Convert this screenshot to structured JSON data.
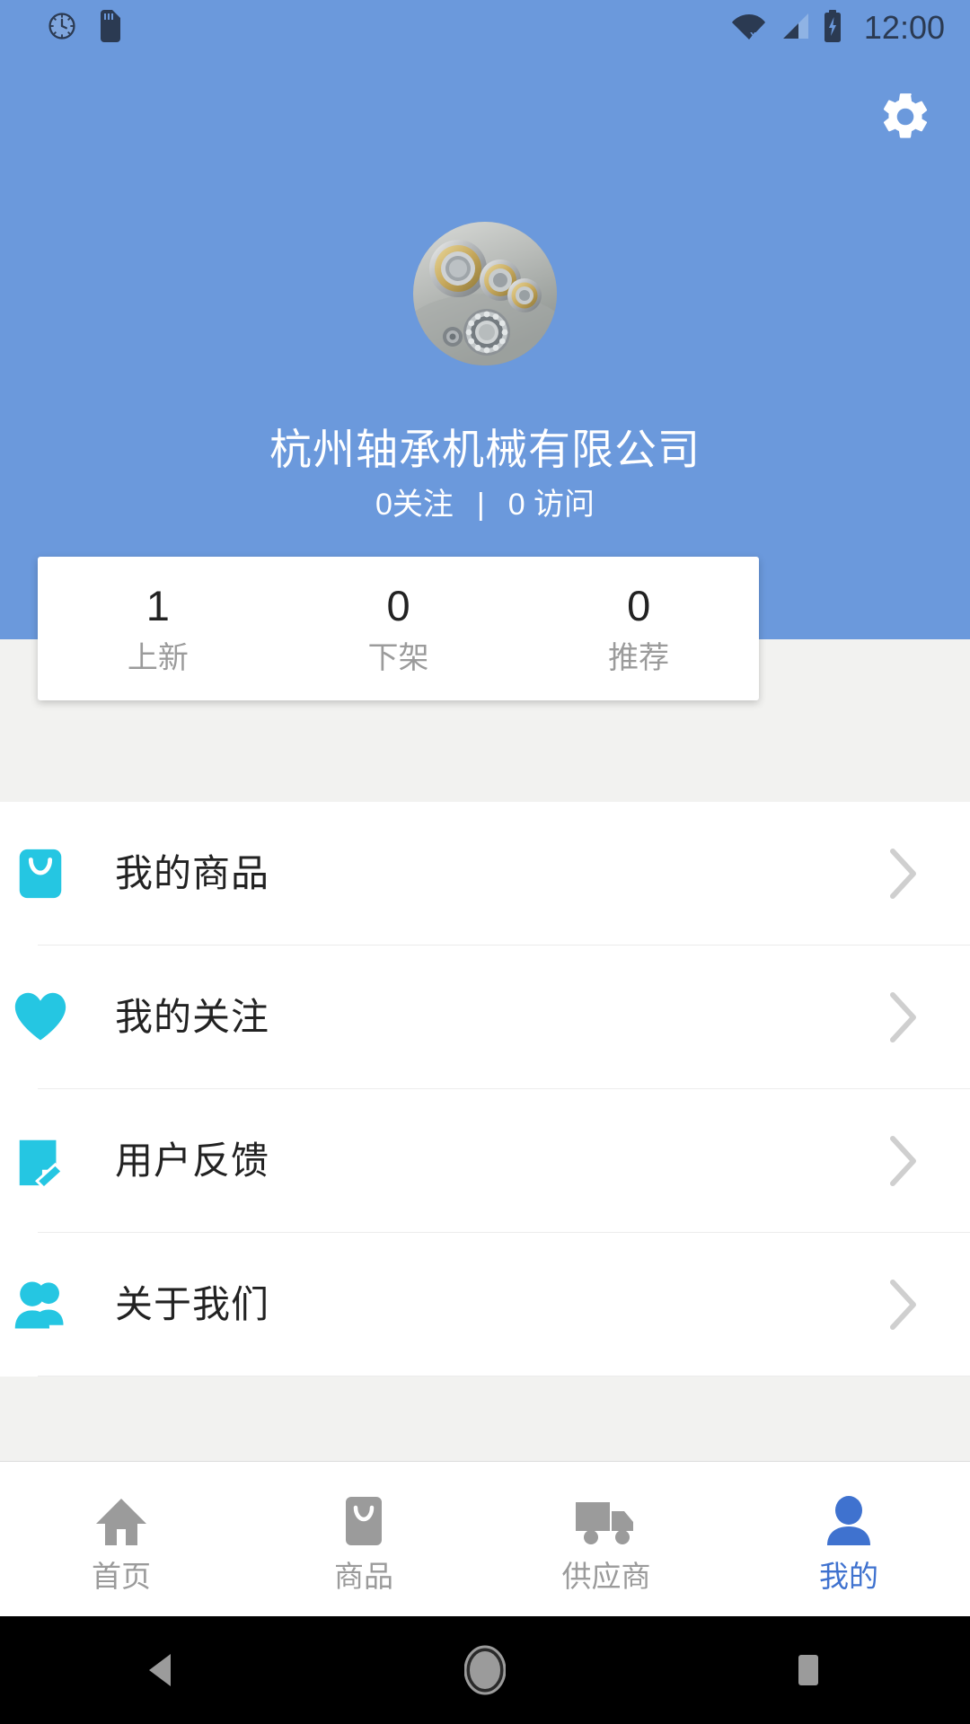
{
  "status_bar": {
    "time": "12:00",
    "icons": [
      "clock-icon",
      "sd-card-icon",
      "wifi-off-icon",
      "cellular-signal-icon",
      "battery-charging-icon"
    ]
  },
  "header": {
    "settings_label": "gear-icon",
    "avatar_alt": "ball-bearings-photo",
    "company_name": "杭州轴承机械有限公司",
    "followers": "0关注",
    "separator": "|",
    "visits": "0 访问",
    "background_color": "#6b99dc"
  },
  "stats": {
    "items": [
      {
        "value": "1",
        "label": "上新"
      },
      {
        "value": "0",
        "label": "下架"
      },
      {
        "value": "0",
        "label": "推荐"
      }
    ]
  },
  "menu": {
    "items": [
      {
        "label": "我的商品",
        "icon": "shopping-bag-icon",
        "icon_color": "#25c6e2"
      },
      {
        "label": "我的关注",
        "icon": "heart-icon",
        "icon_color": "#25c6e2"
      },
      {
        "label": "用户反馈",
        "icon": "edit-note-icon",
        "icon_color": "#25c6e2"
      },
      {
        "label": "关于我们",
        "icon": "people-group-icon",
        "icon_color": "#25c6e2"
      }
    ],
    "chevron": "chevron-right-icon"
  },
  "tab_bar": {
    "active_color": "#3f72cf",
    "inactive_color": "#9b9b9b",
    "tabs": [
      {
        "label": "首页",
        "icon": "home-icon",
        "active": false
      },
      {
        "label": "商品",
        "icon": "shopping-bag-icon",
        "active": false
      },
      {
        "label": "供应商",
        "icon": "truck-icon",
        "active": false
      },
      {
        "label": "我的",
        "icon": "person-icon",
        "active": true
      }
    ]
  },
  "android_nav": {
    "buttons": [
      "back-button",
      "home-button",
      "recents-button"
    ]
  }
}
